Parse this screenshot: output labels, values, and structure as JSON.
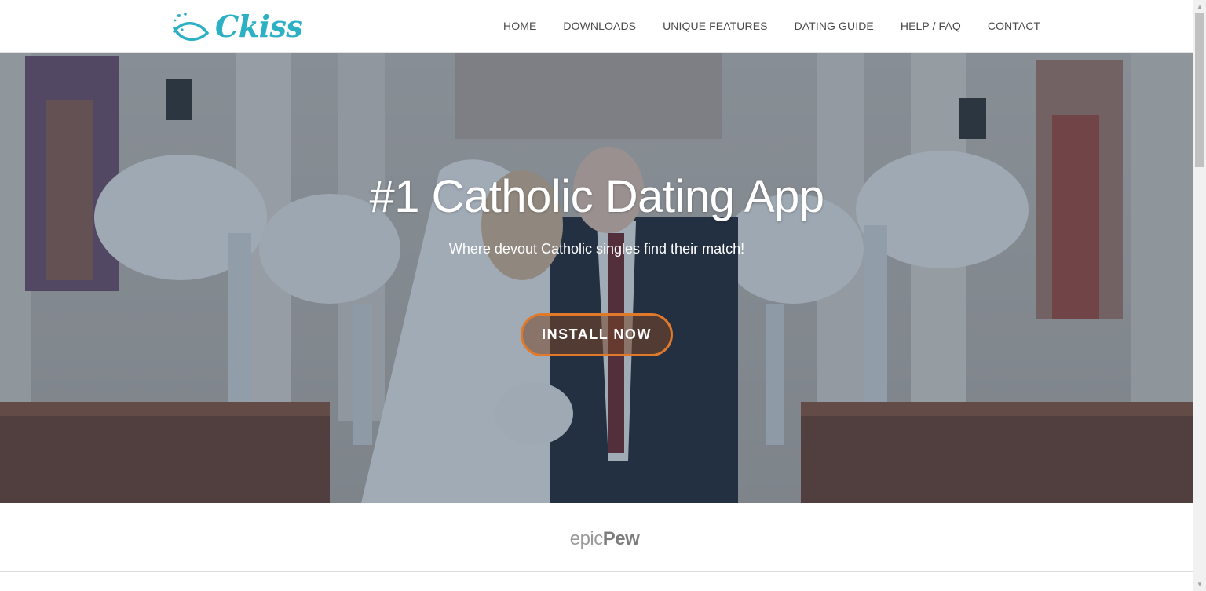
{
  "brand": {
    "name": "Ckiss",
    "color": "#2bb0c4"
  },
  "nav": {
    "items": [
      {
        "label": "HOME"
      },
      {
        "label": "DOWNLOADS"
      },
      {
        "label": "UNIQUE FEATURES"
      },
      {
        "label": "DATING GUIDE"
      },
      {
        "label": "HELP / FAQ"
      },
      {
        "label": "CONTACT"
      }
    ]
  },
  "hero": {
    "title": "#1 Catholic Dating App",
    "subtitle": "Where devout Catholic singles find their match!",
    "cta_label": "INSTALL NOW",
    "cta_color": "#e07a2a"
  },
  "press": {
    "logo_part1": "epic",
    "logo_part2": "Pew"
  },
  "icons": {
    "logo_icon": "fish-icon",
    "scroll_up": "chevron-up-icon",
    "scroll_down": "chevron-down-icon"
  }
}
